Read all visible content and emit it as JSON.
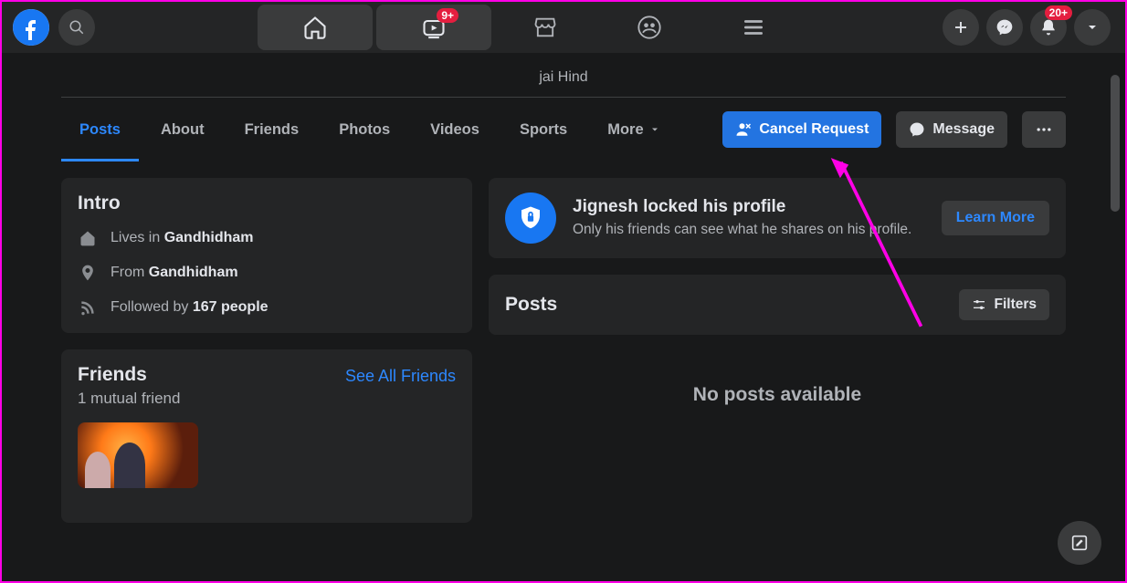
{
  "topnav": {
    "watch_badge": "9+",
    "notif_badge": "20+"
  },
  "profile": {
    "tagline": "jai Hind"
  },
  "tabs": {
    "posts": "Posts",
    "about": "About",
    "friends": "Friends",
    "photos": "Photos",
    "videos": "Videos",
    "sports": "Sports",
    "more": "More"
  },
  "actions": {
    "cancel_request": "Cancel Request",
    "message": "Message"
  },
  "intro": {
    "title": "Intro",
    "lives_prefix": "Lives in ",
    "lives_place": "Gandhidham",
    "from_prefix": "From ",
    "from_place": "Gandhidham",
    "followed_prefix": "Followed by ",
    "followed_count": "167 people"
  },
  "friends": {
    "title": "Friends",
    "see_all": "See All Friends",
    "mutual": "1 mutual friend"
  },
  "lock": {
    "title": "Jignesh locked his profile",
    "desc": "Only his friends can see what he shares on his profile.",
    "learn": "Learn More"
  },
  "posts": {
    "title": "Posts",
    "filters": "Filters",
    "empty": "No posts available"
  }
}
